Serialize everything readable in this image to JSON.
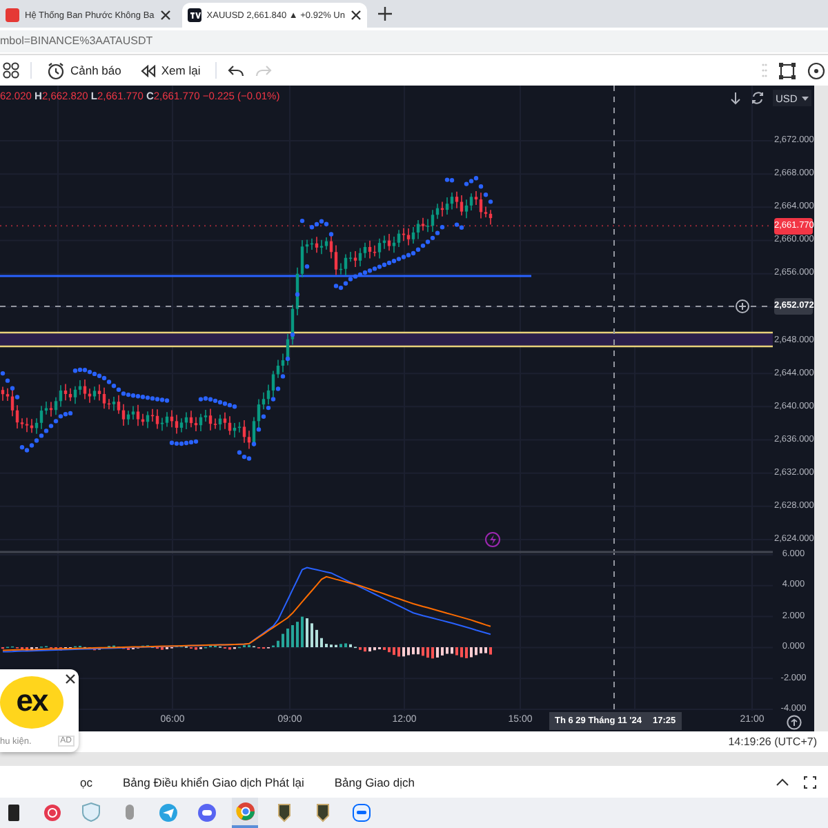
{
  "browser": {
    "tabs": [
      {
        "title": "Hệ Thống Ban Phước Không Ba",
        "selected": false
      },
      {
        "title": "XAUUSD 2,661.840 ▲ +0.92% Un",
        "selected": true
      }
    ],
    "address": "mbol=BINANCE%3AATAUSDT"
  },
  "toolbar": {
    "alert": "Cảnh báo",
    "replay": "Xem lại",
    "redo": {
      "disabled": true
    }
  },
  "chart": {
    "legend": "62.020 **H**2,662.820 **L**2,661.770 **C**2,661.770 −0.225 (−0.01%)",
    "currency": "USD",
    "price_axis": [
      "2,672.000",
      "2,668.000",
      "2,664.000",
      "2,660.000",
      "2,656.000",
      "2,648.000",
      "2,644.000",
      "2,640.000",
      "2,636.000",
      "2,632.000",
      "2,628.000",
      "2,624.000"
    ],
    "last_price": "2,661.770",
    "crosshair_price": "2,652.072",
    "macd_axis": [
      "6.000",
      "4.000",
      "2.000",
      "0.000",
      "-2.000",
      "-4.000"
    ],
    "time_axis": [
      "06:00",
      "09:00",
      "12:00",
      "15:00",
      "21:00"
    ],
    "crosshair_time": {
      "date": "Th 6 29 Tháng 11 '24",
      "time": "17:25"
    }
  },
  "clock": "14:19:26 (UTC+7)",
  "bottom_tabs": [
    "ọc",
    "Bảng Điều khiển Giao dịch Phát lại",
    "Bảng Giao dịch"
  ],
  "ad": {
    "logo": "ex",
    "text": "hu kiện.",
    "badge": "AD"
  }
}
